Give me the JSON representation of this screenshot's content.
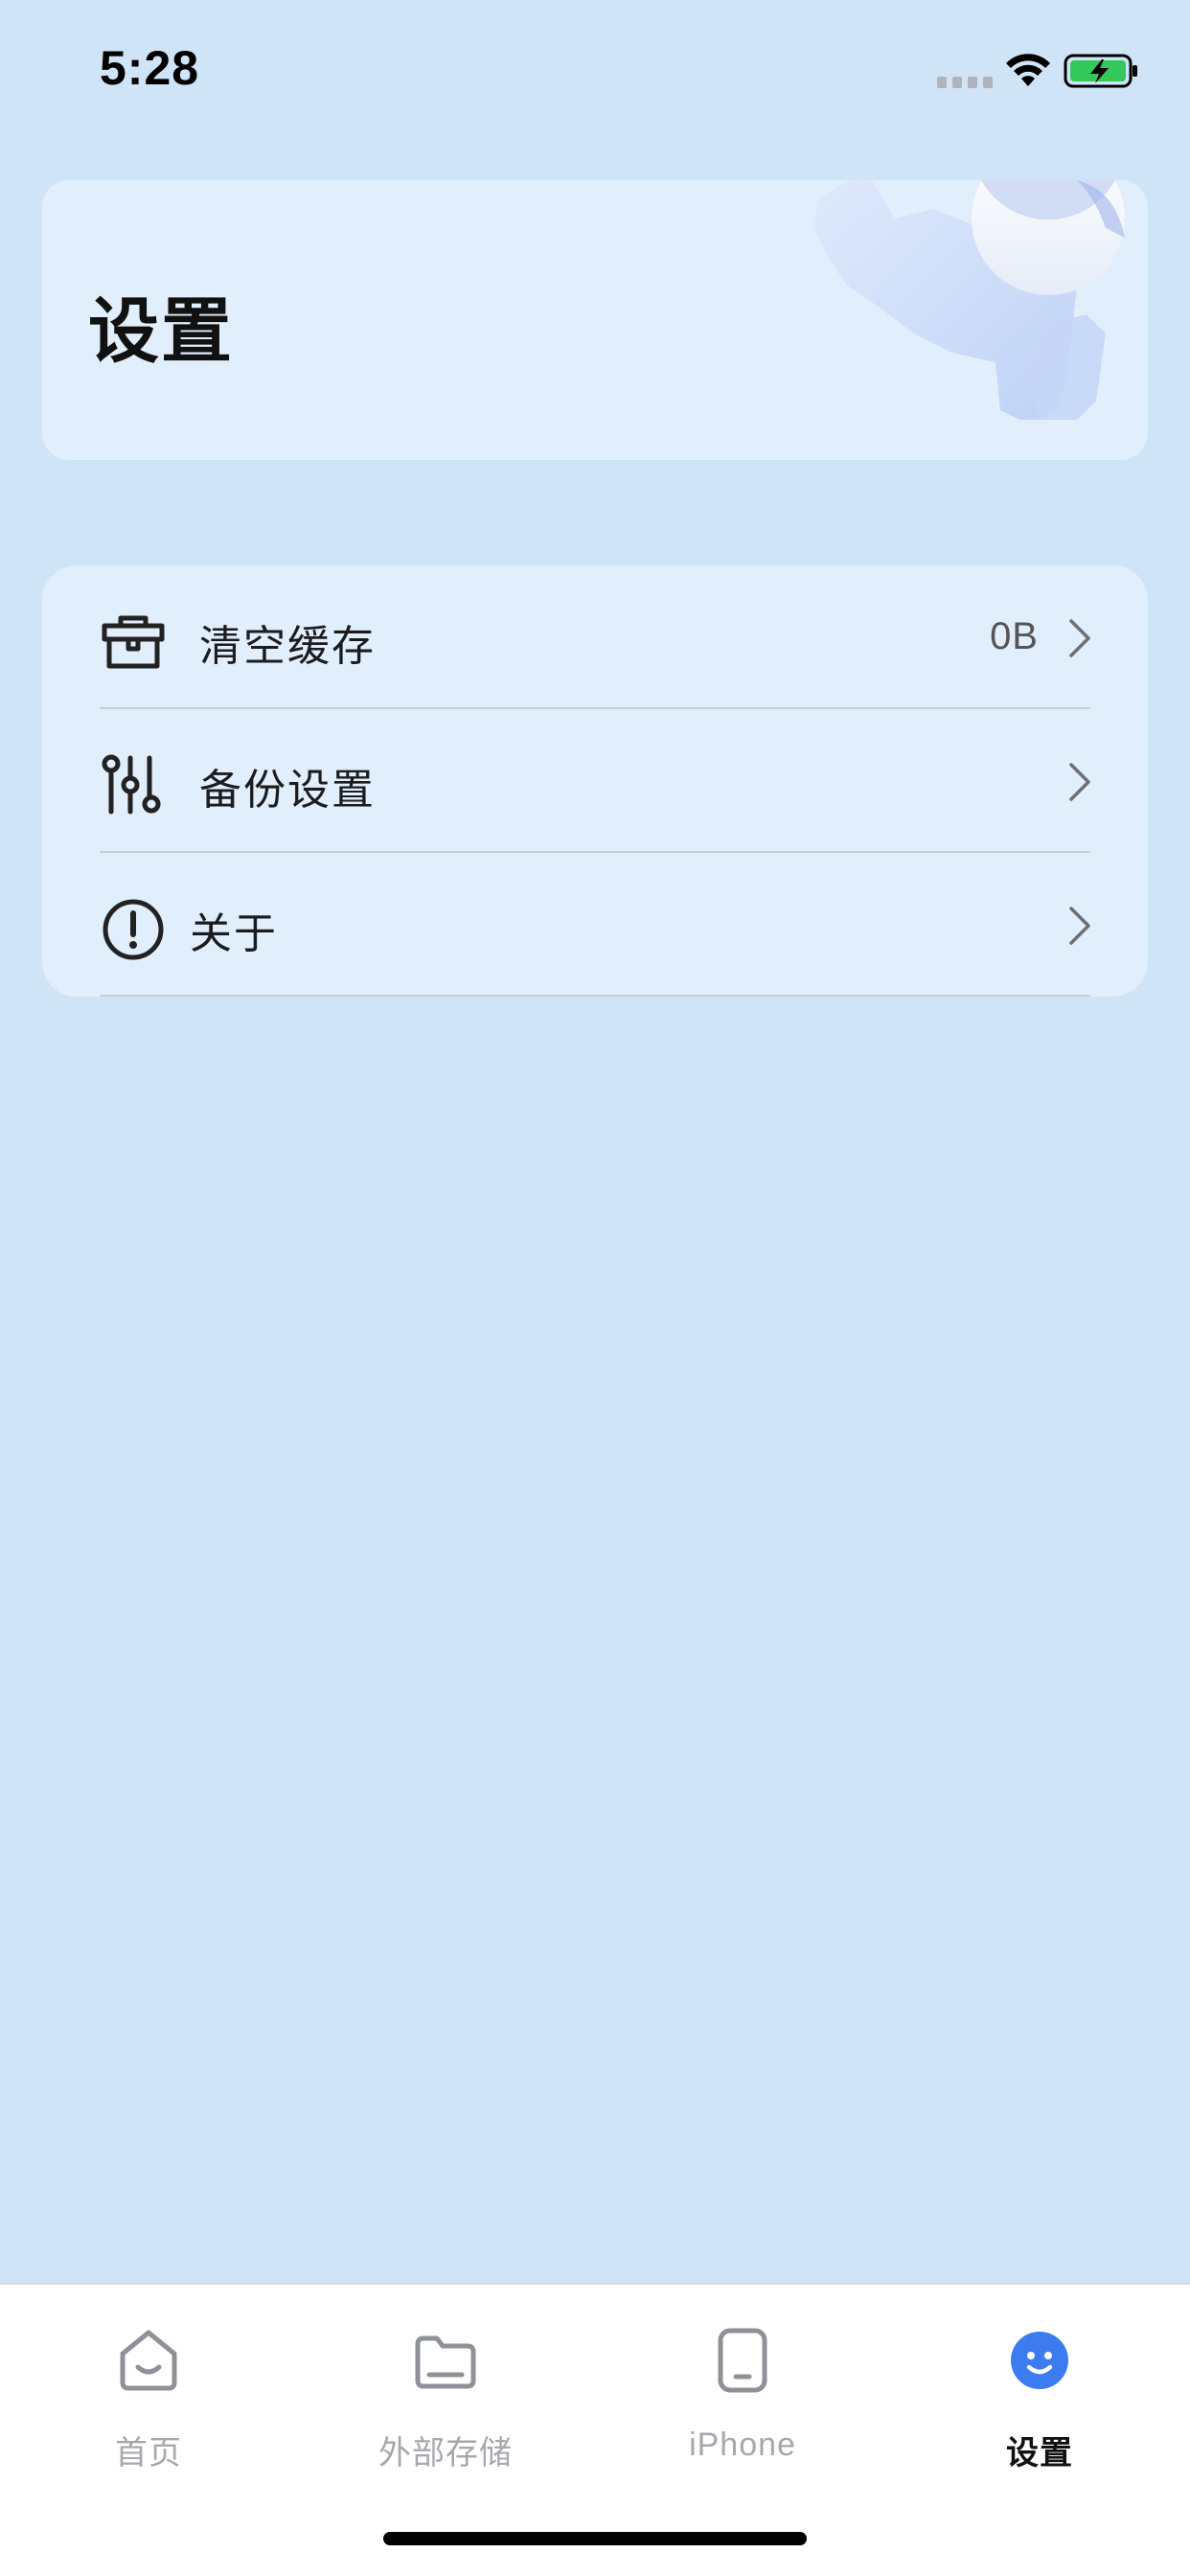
{
  "status_bar": {
    "time": "5:28"
  },
  "header": {
    "title": "设置"
  },
  "settings": {
    "items": [
      {
        "label": "清空缓存",
        "value": "0B",
        "icon": "toolbox-icon"
      },
      {
        "label": "备份设置",
        "value": "",
        "icon": "sliders-icon"
      },
      {
        "label": "关于",
        "value": "",
        "icon": "info-circle-icon"
      }
    ]
  },
  "tab_bar": {
    "tabs": [
      {
        "label": "首页",
        "icon": "home-icon",
        "active": false
      },
      {
        "label": "外部存储",
        "icon": "folder-icon",
        "active": false
      },
      {
        "label": "iPhone",
        "icon": "phone-icon",
        "active": false
      },
      {
        "label": "设置",
        "icon": "smiley-icon",
        "active": true
      }
    ]
  },
  "colors": {
    "background": "#d0e4f8",
    "card": "#e1eefb",
    "active_tab": "#3d7bf0",
    "inactive_tab": "#a5a8ad",
    "battery_green": "#34c759"
  }
}
